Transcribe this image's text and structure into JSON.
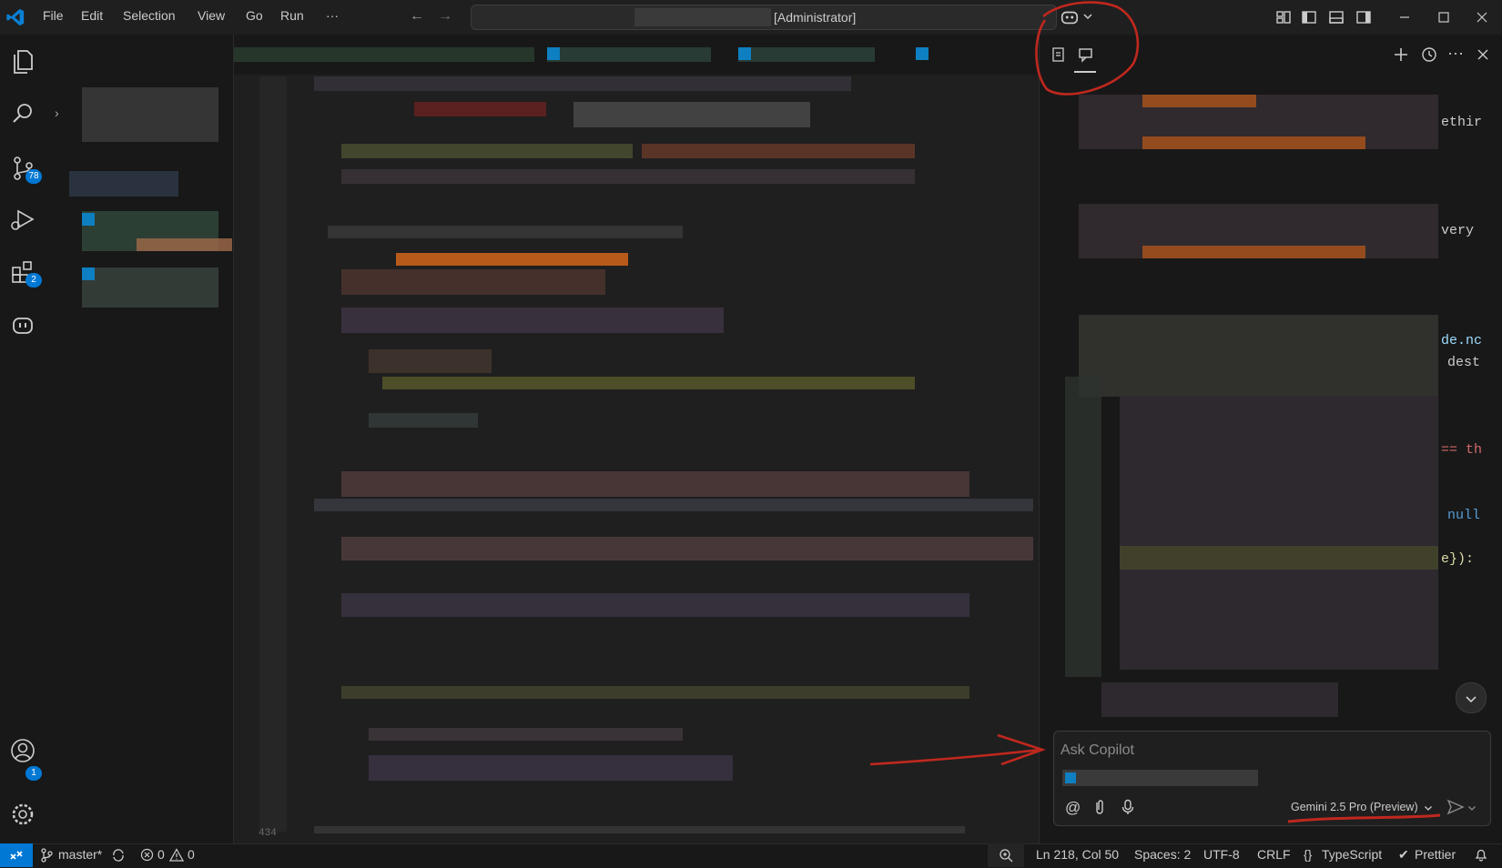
{
  "window": {
    "title_suffix": "[Administrator]"
  },
  "menu": [
    {
      "label": "File"
    },
    {
      "label": "Edit"
    },
    {
      "label": "Selection"
    },
    {
      "label": "View"
    },
    {
      "label": "Go"
    },
    {
      "label": "Run"
    },
    {
      "label": "···"
    }
  ],
  "activity_bar": {
    "source_control_badge": "78",
    "extensions_badge": "2",
    "accounts_badge": "1"
  },
  "editor": {
    "line_number_partial": "434"
  },
  "chat": {
    "input_placeholder": "Ask Copilot",
    "model_label": "Gemini 2.5 Pro (Preview)"
  },
  "status_bar": {
    "branch": "master*",
    "errors": "0",
    "warnings": "0",
    "cursor_position": "Ln 218, Col 50",
    "indentation": "Spaces: 2",
    "encoding": "UTF-8",
    "line_endings": "CRLF",
    "language": "TypeScript",
    "formatter": "Prettier"
  },
  "chat_code_fragments": [
    "ethir",
    "very",
    "de.nc",
    "dest",
    "== th",
    "null",
    "e}):"
  ],
  "colors": {
    "accent": "#0078d4",
    "annotation_red": "#c0281e",
    "background": "#1f1f1f",
    "sidebar_bg": "#181818"
  }
}
